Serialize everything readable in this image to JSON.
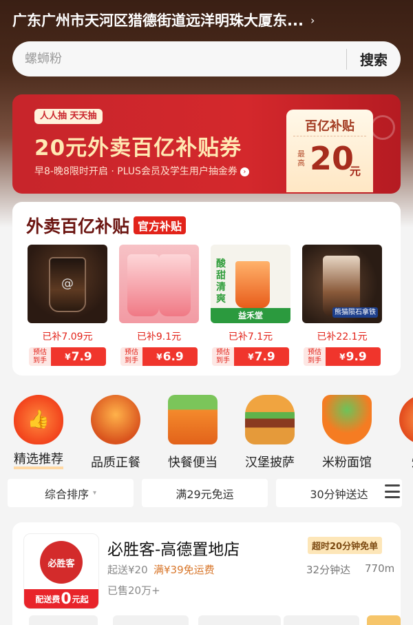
{
  "location": {
    "address": "广东广州市天河区猎德街道远洋明珠大厦东..."
  },
  "search": {
    "placeholder": "螺蛳粉",
    "button": "搜索"
  },
  "banner": {
    "tag": "人人抽 天天抽",
    "headline": "20元外卖百亿补贴券",
    "sub": "早8-晚8限时开启 · PLUS会员及学生用户抽金券",
    "coupon_title": "百亿补贴",
    "coupon_max": "最高",
    "coupon_amount": "20",
    "coupon_unit": "元"
  },
  "subsidy": {
    "title": "外卖百亿补贴",
    "badge": "官方补贴",
    "products": [
      {
        "saved": "已补7.09元",
        "est": "预估到手",
        "currency": "¥",
        "price": "7.9"
      },
      {
        "saved": "已补9.1元",
        "est": "预估到手",
        "currency": "¥",
        "price": "6.9"
      },
      {
        "saved": "已补7.1元",
        "est": "预估到手",
        "currency": "¥",
        "price": "7.9",
        "thumb_text": "酸甜清爽",
        "thumb_brand": "益禾堂"
      },
      {
        "saved": "已补22.1元",
        "est": "预估到手",
        "currency": "¥",
        "price": "9.9",
        "thumb_label": "熊猫陨石拿铁"
      }
    ]
  },
  "categories": [
    {
      "label": "精选推荐",
      "icon": "thumbs-up-fire-icon"
    },
    {
      "label": "品质正餐",
      "icon": "roast-chicken-icon"
    },
    {
      "label": "快餐便当",
      "icon": "takeout-box-icon"
    },
    {
      "label": "汉堡披萨",
      "icon": "burger-icon"
    },
    {
      "label": "米粉面馆",
      "icon": "noodle-bowl-icon"
    },
    {
      "label": "烤串",
      "icon": "grill-icon"
    }
  ],
  "filters": [
    {
      "label": "综合排序",
      "caret": "▾"
    },
    {
      "label": "满29元免运"
    },
    {
      "label": "30分钟送达"
    }
  ],
  "store": {
    "logo_text": "必胜客",
    "logo_foot_pre": "配送费",
    "logo_foot_num": "0",
    "logo_foot_post": "元起",
    "name": "必胜客-高德置地店",
    "overtime": "超时20分钟免单",
    "min_order": "起送¥20",
    "free_ship": "满¥39免运费",
    "time": "32分钟达",
    "distance": "770m",
    "sold": "已售20万+"
  }
}
